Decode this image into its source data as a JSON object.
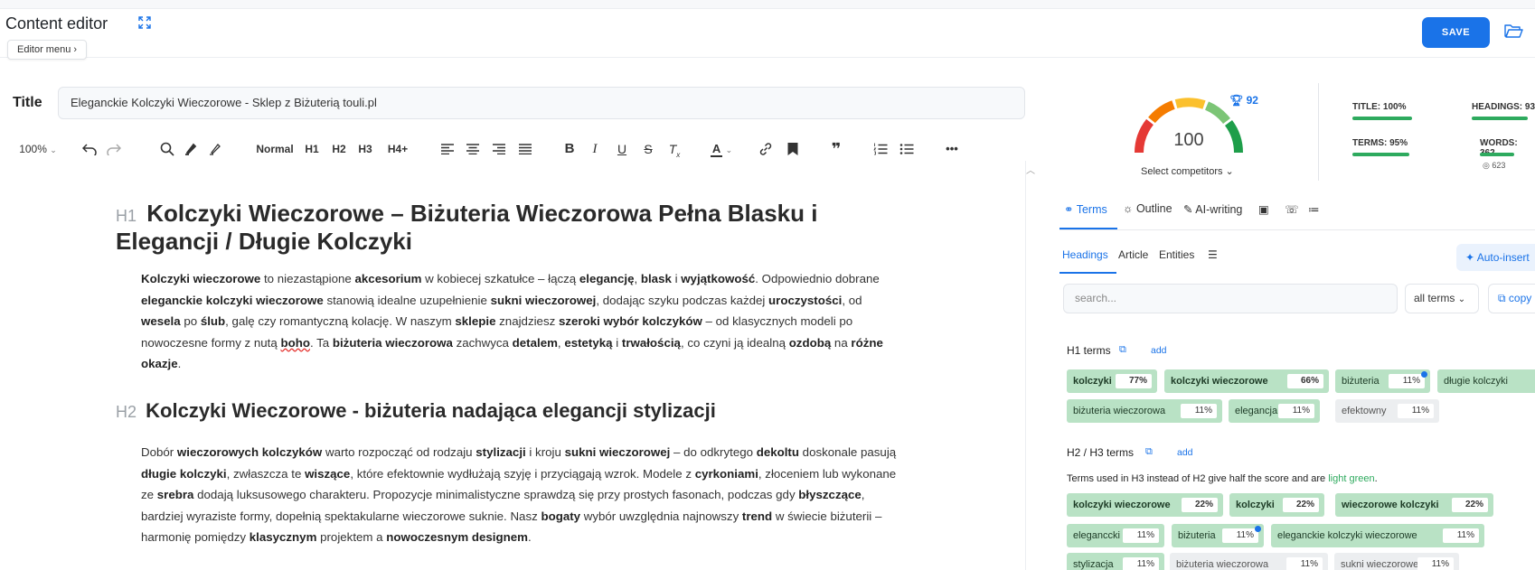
{
  "header": {
    "title": "Content editor",
    "editor_menu": "Editor menu",
    "save": "SAVE",
    "icons": [
      "expand-icon",
      "folder-open-icon"
    ]
  },
  "title_field": {
    "label": "Title",
    "value": "Eleganckie Kolczyki Wieczorowe - Sklep z Biżuterią touli.pl"
  },
  "toolbar": {
    "zoom": "100%",
    "styles": [
      "Normal",
      "H1",
      "H2",
      "H3",
      "H4+"
    ],
    "more": "•••"
  },
  "document": {
    "h1_tag": "H1",
    "h1": "Kolczyki Wieczorowe – Biżuteria Wieczorowa Pełna Blasku i Elegancji / Długie Kolczyki",
    "h2_tag": "H2",
    "h2": "Kolczyki Wieczorowe - biżuteria nadająca elegancji stylizacji"
  },
  "score": {
    "value": "100",
    "competitor_score": "92",
    "select_competitors": "Select competitors",
    "stats": [
      {
        "label": "TITLE: 100%",
        "value": 1.0
      },
      {
        "label": "HEADINGS: 93",
        "value": 0.93
      },
      {
        "label": "TERMS: 95%",
        "value": 0.95
      },
      {
        "label": "WORDS: 362",
        "value": 0.58
      }
    ],
    "words_target": "623"
  },
  "tabs": {
    "main": [
      "Terms",
      "Outline",
      "AI-writing"
    ],
    "sub": [
      "Headings",
      "Article",
      "Entities"
    ],
    "auto_insert": "Auto-insert"
  },
  "terms_panel": {
    "search_placeholder": "search...",
    "filter": "all terms",
    "copy": "copy",
    "h1_label": "H1 terms",
    "h23_label": "H2 / H3 terms",
    "add": "add",
    "note_prefix": "Terms used in H3 instead of H2 give half the score and are ",
    "note_highlight": "light green",
    "note_suffix": ".",
    "h1_terms": [
      {
        "term": "kolczyki",
        "pct": "77%",
        "state": "bold"
      },
      {
        "term": "kolczyki wieczorowe",
        "pct": "66%",
        "state": "bold"
      },
      {
        "term": "biżuteria",
        "pct": "11%",
        "state": "light",
        "dot": true
      },
      {
        "term": "długie kolczyki",
        "pct": "",
        "state": "light"
      },
      {
        "term": "biżuteria wieczorowa",
        "pct": "11%",
        "state": "light"
      },
      {
        "term": "elegancja",
        "pct": "11%",
        "state": "light"
      },
      {
        "term": "efektowny",
        "pct": "11%",
        "state": "none"
      }
    ],
    "h23_terms": [
      {
        "term": "kolczyki wieczorowe",
        "pct": "22%",
        "state": "bold"
      },
      {
        "term": "kolczyki",
        "pct": "22%",
        "state": "bold"
      },
      {
        "term": "wieczorowe kolczyki",
        "pct": "22%",
        "state": "bold"
      },
      {
        "term": "eleganccki",
        "pct": "11%",
        "state": "light"
      },
      {
        "term": "biżuteria",
        "pct": "11%",
        "state": "light",
        "dot": true
      },
      {
        "term": "eleganckie kolczyki wieczorowe",
        "pct": "11%",
        "state": "light"
      },
      {
        "term": "stylizacja",
        "pct": "11%",
        "state": "light"
      },
      {
        "term": "biżuteria wieczorowa",
        "pct": "11%",
        "state": "none"
      },
      {
        "term": "sukni wieczorowej",
        "pct": "11%",
        "state": "none"
      }
    ]
  },
  "colors": {
    "accent": "#1a73e8",
    "term_green": "#b9e2c5",
    "term_grey": "#eceef0"
  }
}
